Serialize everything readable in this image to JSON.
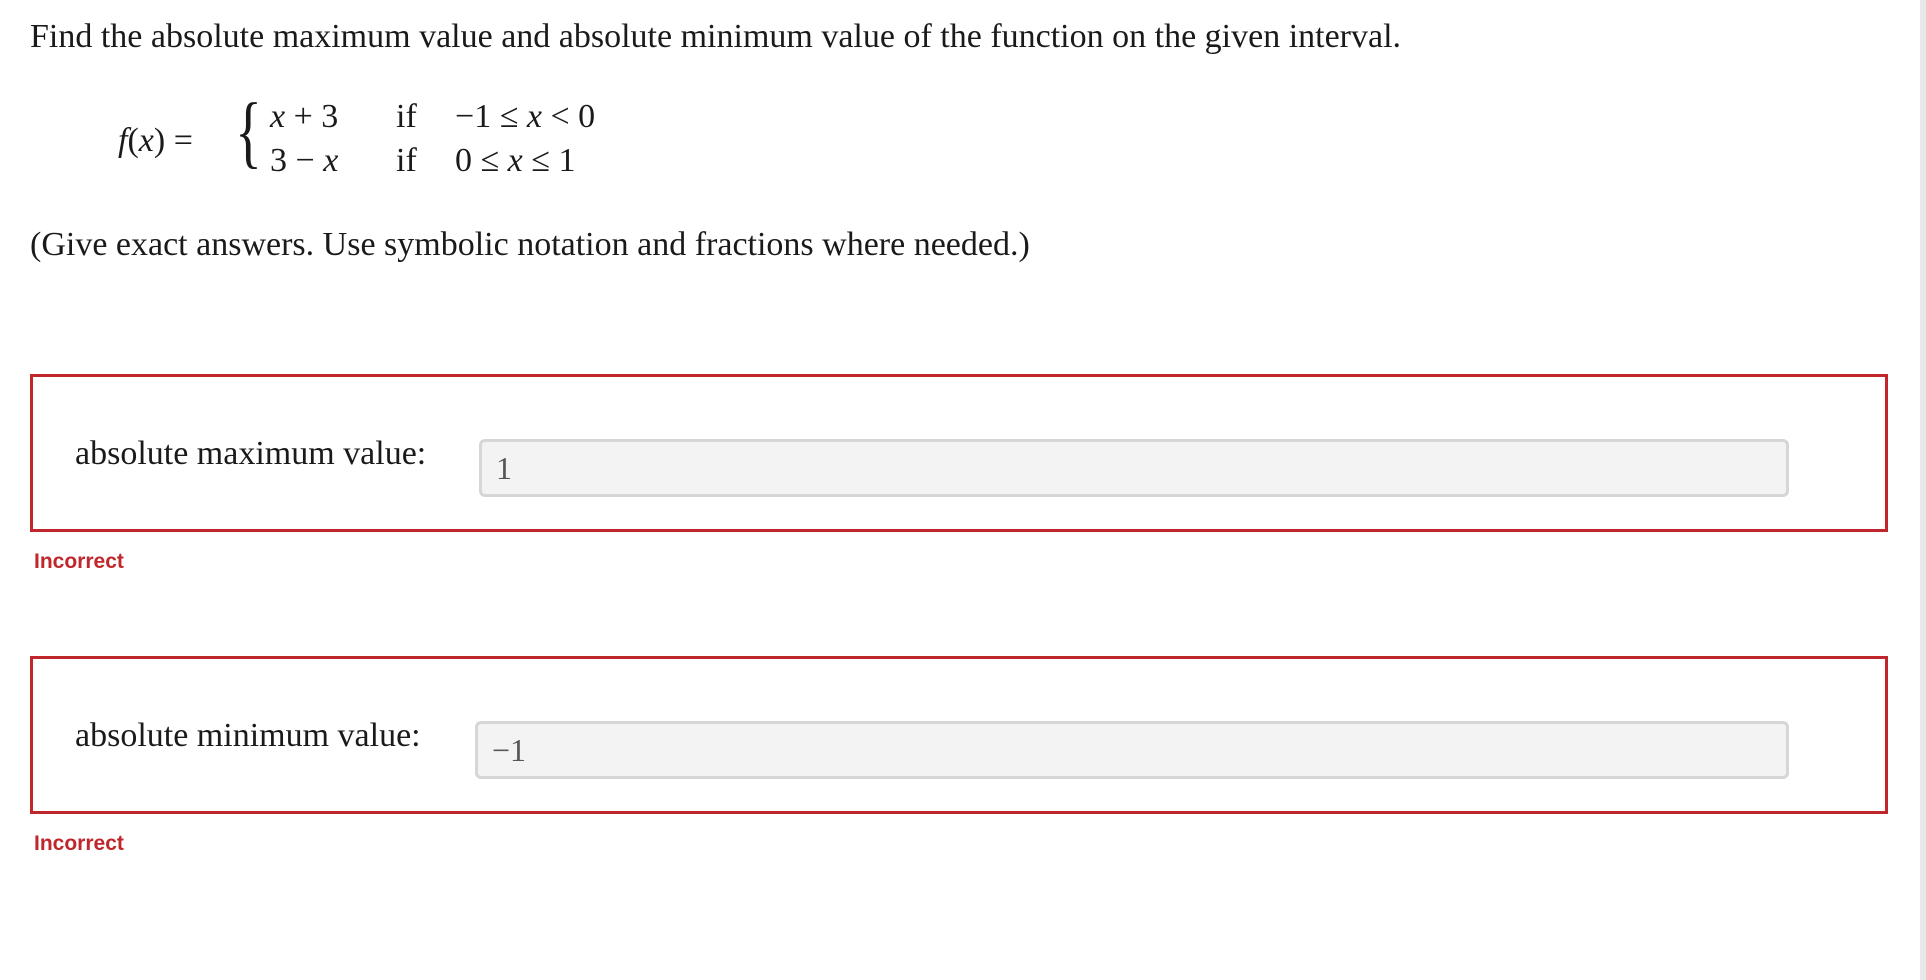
{
  "question": {
    "prompt": "Find the absolute maximum value and absolute minimum value of the function on the given interval.",
    "function_name": "f(x) =",
    "cases": [
      {
        "expression": "x + 3",
        "if_label": "if",
        "condition": "−1 ≤ x < 0"
      },
      {
        "expression": "3 − x",
        "if_label": "if",
        "condition": "0 ≤ x ≤ 1"
      }
    ],
    "note": "(Give exact answers. Use symbolic notation and fractions where needed.)"
  },
  "answers": {
    "maximum": {
      "label": "absolute maximum value:",
      "value": "1",
      "feedback": "Incorrect"
    },
    "minimum": {
      "label": "absolute minimum value:",
      "value": "−1",
      "feedback": "Incorrect"
    }
  },
  "colors": {
    "error": "#c0272d",
    "input_background": "#f3f3f3",
    "input_border": "#d6d6d6"
  }
}
